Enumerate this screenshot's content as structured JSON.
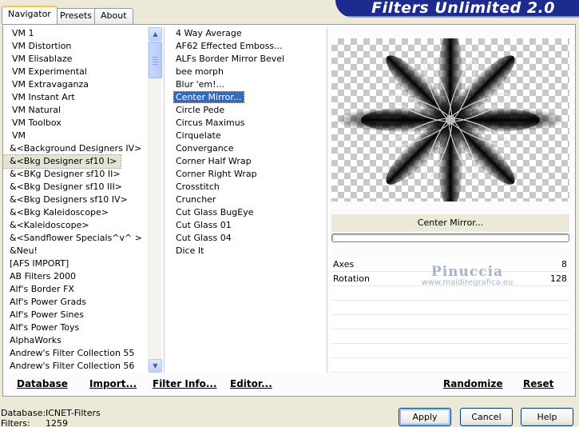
{
  "banner": {
    "title": "Filters Unlimited 2.0"
  },
  "tabs": [
    {
      "label": "Navigator",
      "active": true
    },
    {
      "label": "Presets",
      "active": false
    },
    {
      "label": "About",
      "active": false
    }
  ],
  "categories": [
    "VM 1",
    "VM Distortion",
    "VM Elisablaze",
    "VM Experimental",
    "VM Extravaganza",
    "VM Instant Art",
    "VM Natural",
    "VM Toolbox",
    "VM",
    "&<Background Designers IV>",
    "&<Bkg Designer sf10 I>",
    "&<BKg Designer sf10 II>",
    "&<Bkg Designer sf10 III>",
    "&<Bkg Designers sf10 IV>",
    "&<Bkg Kaleidoscope>",
    "&<Kaleidoscope>",
    "&<Sandflower Specials^v^ >",
    "&Neu!",
    "[AFS IMPORT]",
    "AB Filters 2000",
    "Alf's Border FX",
    "Alf's Power Grads",
    "Alf's Power Sines",
    "Alf's Power Toys",
    "AlphaWorks",
    "Andrew's Filter Collection 55",
    "Andrew's Filter Collection 56"
  ],
  "selected_category_index": 10,
  "filters": [
    "4 Way Average",
    "AF62 Effected Emboss...",
    "ALFs Border Mirror Bevel",
    "bee morph",
    "Blur 'em!...",
    "Center Mirror...",
    "Circle Pede",
    "Circus Maximus",
    "Cirquelate",
    "Convergance",
    "Corner Half Wrap",
    "Corner Right Wrap",
    "Crosstitch",
    "Cruncher",
    "Cut Glass  BugEye",
    "Cut Glass 01",
    "Cut Glass 04",
    "Dice It"
  ],
  "selected_filter_index": 5,
  "filter_name": "Center Mirror...",
  "params": [
    {
      "name": "Axes",
      "value": "8"
    },
    {
      "name": "Rotation",
      "value": "128"
    }
  ],
  "watermark": {
    "line1": "Pinuccia",
    "line2": "www.maidiregrafica.eu"
  },
  "links": {
    "database": "Database",
    "import": "Import...",
    "filter_info": "Filter Info...",
    "editor": "Editor...",
    "randomize": "Randomize",
    "reset": "Reset"
  },
  "status": {
    "database_label": "Database:",
    "database_value": "ICNET-Filters",
    "filters_label": "Filters:",
    "filters_value": "1259"
  },
  "buttons": {
    "apply": "Apply",
    "cancel": "Cancel",
    "help": "Help"
  },
  "scrollbar": {
    "position": 0.05
  },
  "icons": {
    "scroll_up": "scroll-up-arrow-icon",
    "scroll_down": "scroll-down-arrow-icon"
  },
  "colors": {
    "banner": "#1d2a8e",
    "selection": "#316ac5",
    "watermark": "#a7b3cd"
  }
}
